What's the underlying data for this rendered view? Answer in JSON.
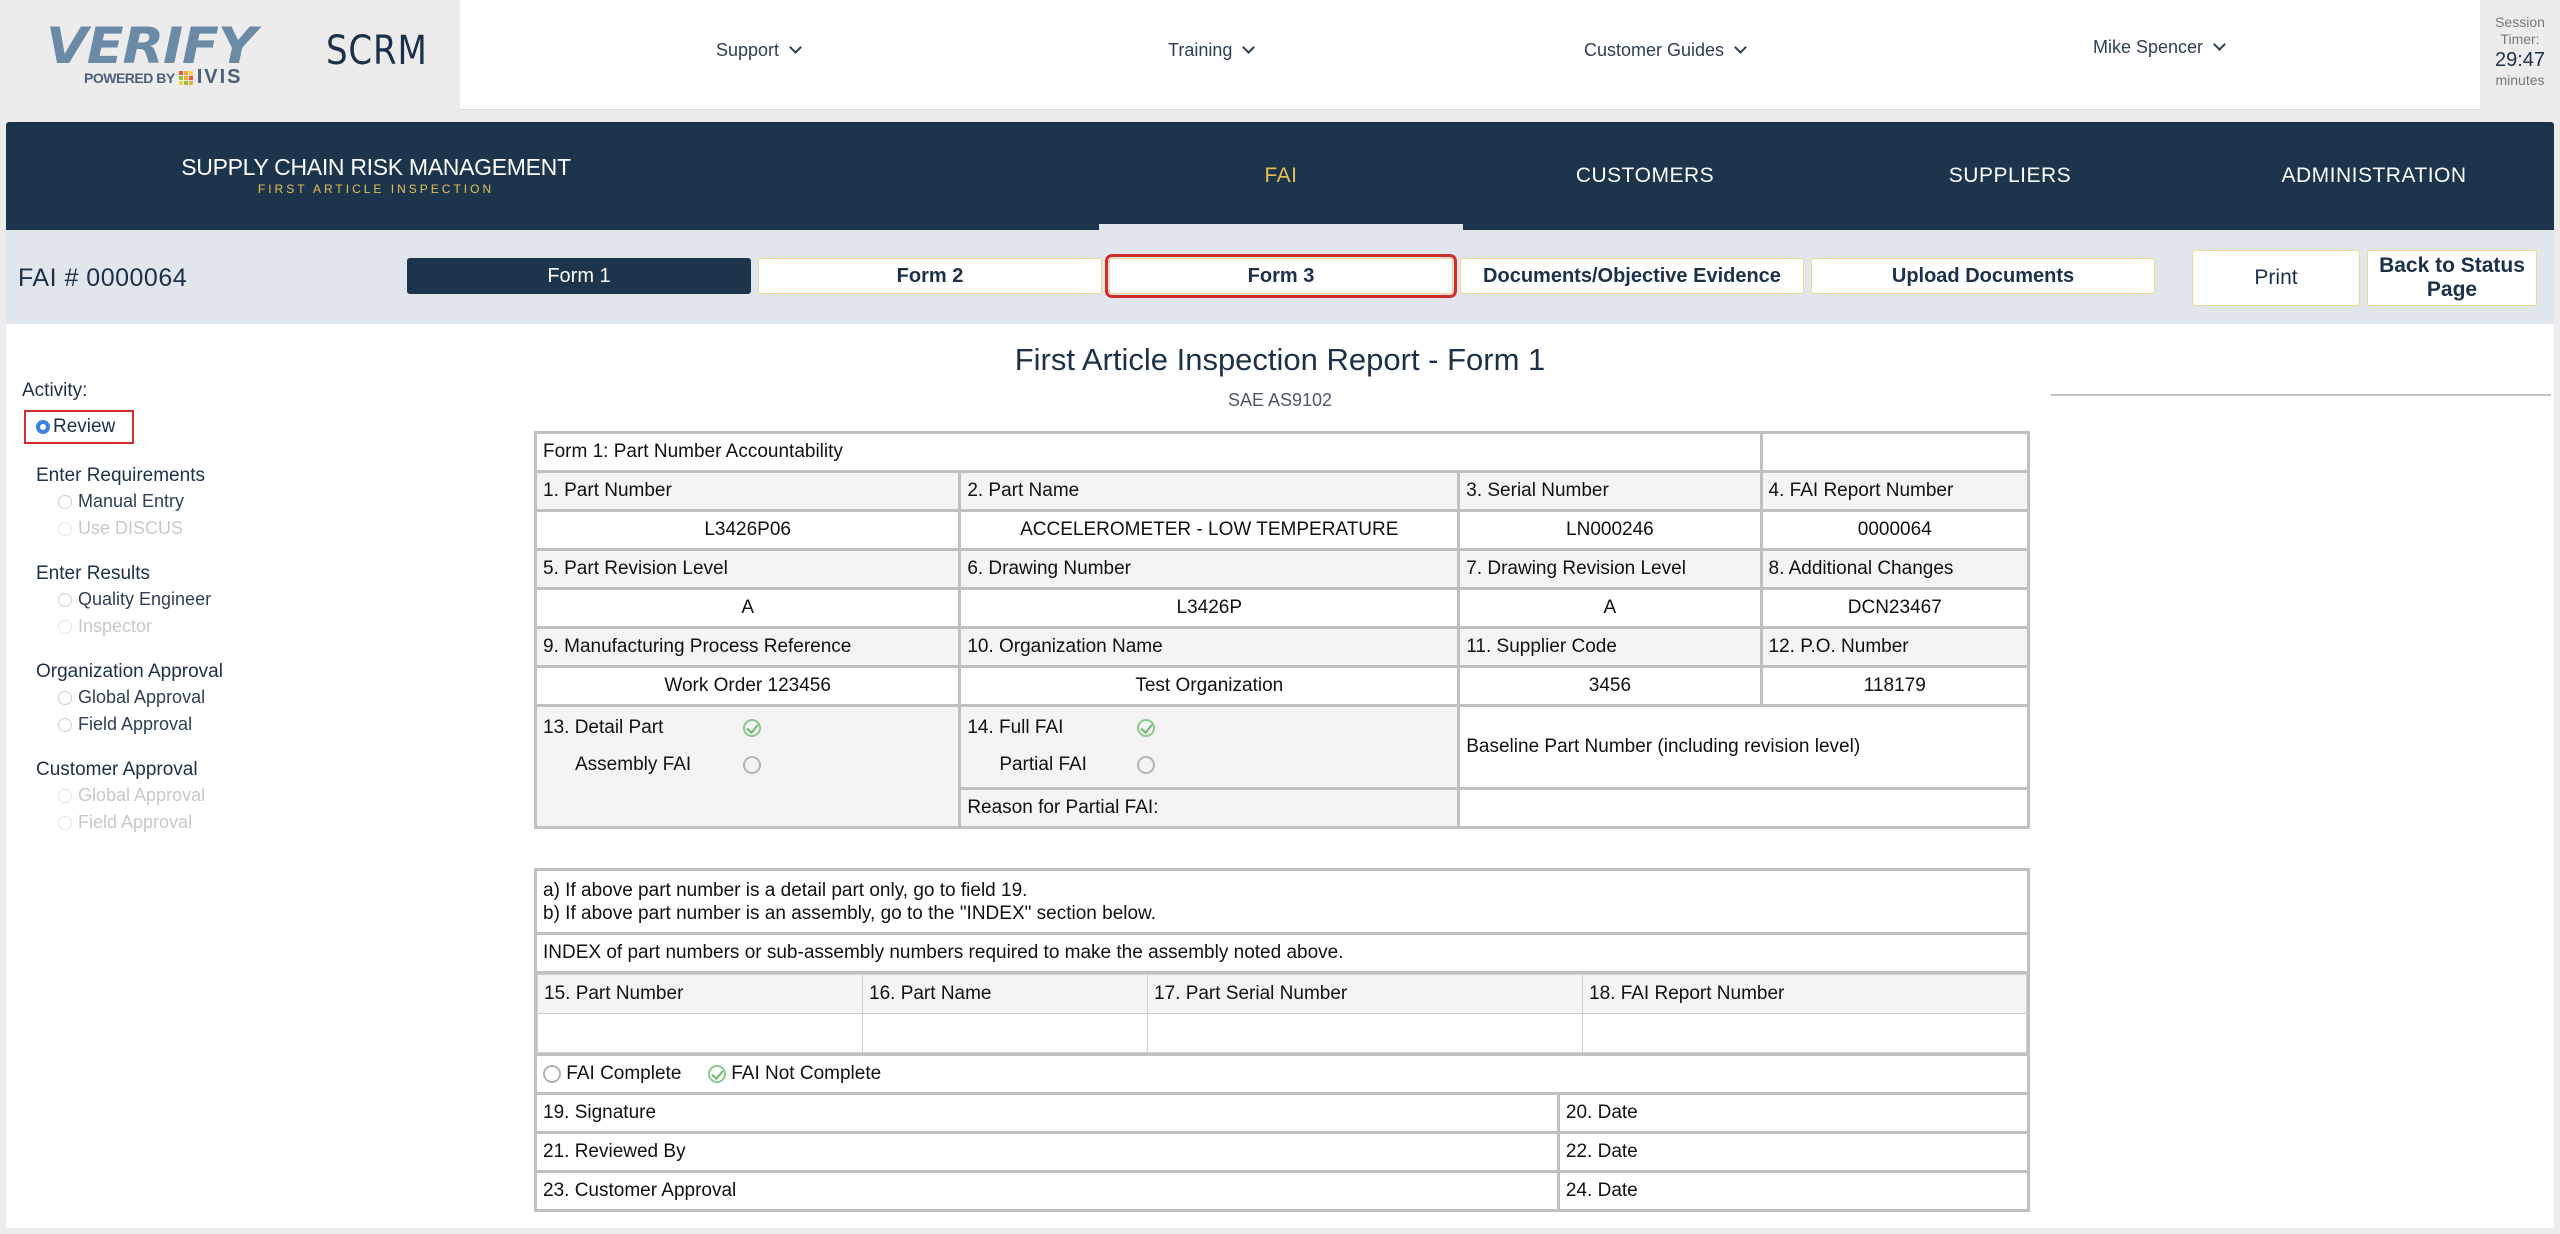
{
  "brand": {
    "logo_word": "VERIFY",
    "logo_powered_by": "POWERED BY",
    "logo_ivis": "IVIS",
    "app_name": "SCRM"
  },
  "top_nav": [
    {
      "label": "Support",
      "icon": "chevron-down-icon"
    },
    {
      "label": "Training",
      "icon": "chevron-down-icon"
    },
    {
      "label": "Customer Guides",
      "icon": "chevron-down-icon"
    },
    {
      "label": "Mike Spencer",
      "icon": "chevron-down-icon"
    }
  ],
  "session_timer": {
    "label_line1": "Session",
    "label_line2": "Timer:",
    "value": "29:47",
    "unit": "minutes"
  },
  "main_nav": {
    "title": "SUPPLY CHAIN RISK MANAGEMENT",
    "subtitle": "FIRST ARTICLE INSPECTION",
    "tabs": [
      {
        "label": "FAI",
        "active": true
      },
      {
        "label": "CUSTOMERS",
        "active": false
      },
      {
        "label": "SUPPLIERS",
        "active": false
      },
      {
        "label": "ADMINISTRATION",
        "active": false
      }
    ],
    "accent_color": "#e6c055",
    "band_color": "#1c344c"
  },
  "form_bar": {
    "fai_number": "FAI # 0000064",
    "tabs": [
      {
        "label": "Form 1",
        "active": true
      },
      {
        "label": "Form 2",
        "active": false
      },
      {
        "label": "Form 3",
        "active": false,
        "highlighted": true
      },
      {
        "label": "Documents/Objective Evidence",
        "active": false
      },
      {
        "label": "Upload Documents",
        "active": false
      }
    ],
    "print_label": "Print",
    "back_label_line1": "Back to Status",
    "back_label_line2": "Page"
  },
  "sidebar": {
    "activity_label": "Activity:",
    "selected": "Review",
    "groups": [
      {
        "title": "Enter Requirements",
        "options": [
          {
            "label": "Manual Entry",
            "enabled": true
          },
          {
            "label": "Use DISCUS",
            "enabled": false
          }
        ]
      },
      {
        "title": "Enter Results",
        "options": [
          {
            "label": "Quality Engineer",
            "enabled": true
          },
          {
            "label": "Inspector",
            "enabled": false
          }
        ]
      },
      {
        "title": "Organization Approval",
        "options": [
          {
            "label": "Global Approval",
            "enabled": true
          },
          {
            "label": "Field Approval",
            "enabled": true
          }
        ]
      },
      {
        "title": "Customer Approval",
        "options": [
          {
            "label": "Global Approval",
            "enabled": false
          },
          {
            "label": "Field Approval",
            "enabled": false
          }
        ]
      }
    ]
  },
  "report": {
    "title": "First Article Inspection Report - Form 1",
    "standard": "SAE AS9102",
    "section_title": "Form 1: Part Number Accountability",
    "fields": [
      {
        "label": "1. Part Number",
        "value": "L3426P06"
      },
      {
        "label": "2. Part Name",
        "value": "ACCELEROMETER - LOW TEMPERATURE"
      },
      {
        "label": "3. Serial Number",
        "value": "LN000246"
      },
      {
        "label": "4. FAI Report Number",
        "value": "0000064"
      },
      {
        "label": "5. Part Revision Level",
        "value": "A"
      },
      {
        "label": "6. Drawing Number",
        "value": "L3426P"
      },
      {
        "label": "7. Drawing Revision Level",
        "value": "A"
      },
      {
        "label": "8. Additional Changes",
        "value": "DCN23467"
      },
      {
        "label": "9. Manufacturing Process Reference",
        "value": "Work Order 123456"
      },
      {
        "label": "10. Organization Name",
        "value": "Test Organization"
      },
      {
        "label": "11. Supplier Code",
        "value": "3456"
      },
      {
        "label": "12. P.O. Number",
        "value": "118179"
      }
    ],
    "part_type": {
      "label_detail": "13. Detail Part",
      "detail_checked": true,
      "label_assembly": "Assembly FAI",
      "assembly_checked": false
    },
    "fai_type": {
      "label_full": "14. Full FAI",
      "full_checked": true,
      "label_partial": "Partial FAI",
      "partial_checked": false,
      "reason_label": "Reason for Partial FAI:",
      "reason_value": ""
    },
    "baseline_label": "Baseline Part Number (including revision level)",
    "baseline_value": "",
    "instructions_a": "a) If above part number is a detail part only, go to field 19.",
    "instructions_b": "b) If above part number is an assembly, go to the \"INDEX\" section below.",
    "index_title": "INDEX of part numbers or sub-assembly numbers required to make the assembly noted above.",
    "index_columns": [
      "15. Part Number",
      "16. Part Name",
      "17. Part Serial Number",
      "18. FAI Report Number"
    ],
    "index_rows": [
      [
        "",
        "",
        "",
        ""
      ]
    ],
    "completion": {
      "complete_label": "FAI Complete",
      "complete_checked": false,
      "not_complete_label": "FAI Not Complete",
      "not_complete_checked": true
    },
    "signatures": [
      {
        "label": "19. Signature",
        "date_label": "20. Date"
      },
      {
        "label": "21. Reviewed By",
        "date_label": "22. Date"
      },
      {
        "label": "23. Customer Approval",
        "date_label": "24. Date"
      }
    ]
  }
}
